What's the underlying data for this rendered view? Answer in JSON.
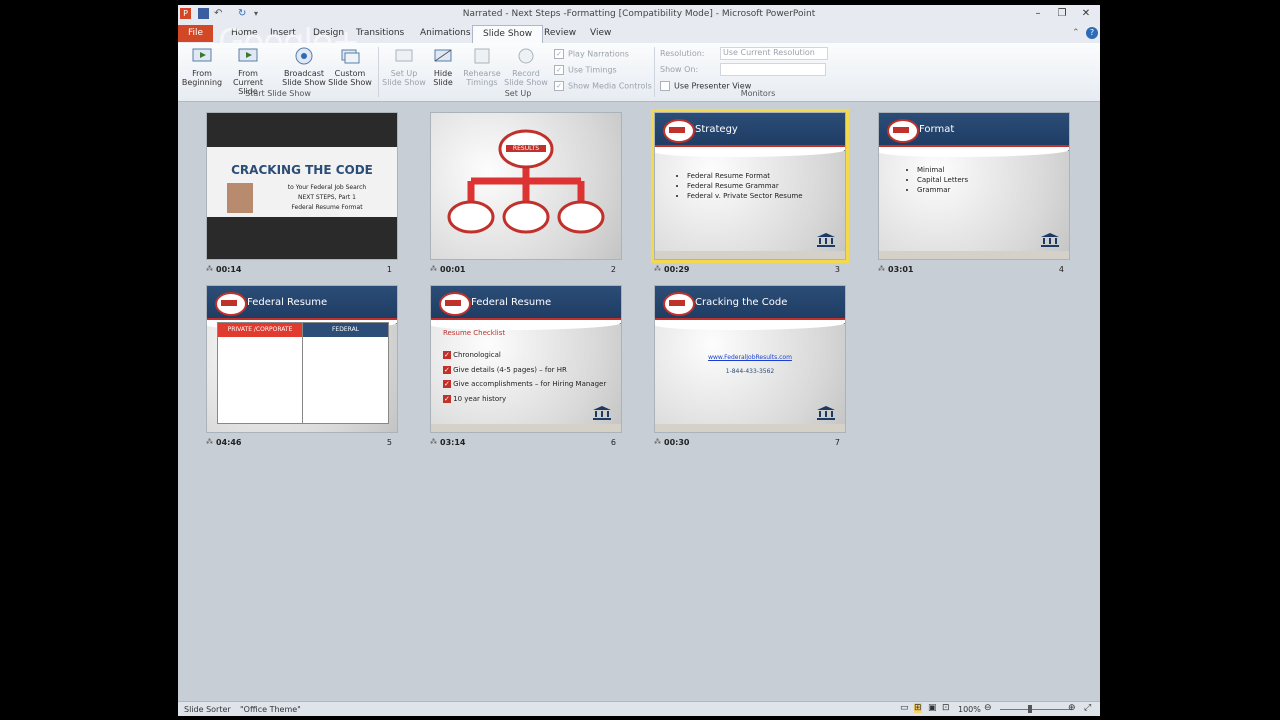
{
  "window": {
    "title": "Narrated - Next Steps -Formatting [Compatibility Mode] - Microsoft PowerPoint"
  },
  "overlay": {
    "text": "Google+"
  },
  "tabs": [
    "File",
    "Home",
    "Insert",
    "Design",
    "Transitions",
    "Animations",
    "Slide Show",
    "Review",
    "View"
  ],
  "ribbon": {
    "start": {
      "from_beginning": "From Beginning",
      "from_current": "From Current Slide",
      "broadcast": "Broadcast Slide Show",
      "custom": "Custom Slide Show",
      "group": "Start Slide Show"
    },
    "setup": {
      "setup_show": "Set Up Slide Show",
      "hide_slide": "Hide Slide",
      "rehearse": "Rehearse Timings",
      "record": "Record Slide Show",
      "play_narrations": "Play Narrations",
      "use_timings": "Use Timings",
      "show_media": "Show Media Controls",
      "group": "Set Up"
    },
    "monitors": {
      "resolution_label": "Resolution:",
      "resolution_value": "Use Current Resolution",
      "show_on_label": "Show On:",
      "presenter_view": "Use Presenter View",
      "group": "Monitors"
    }
  },
  "slides": [
    {
      "num": "1",
      "time": "00:14",
      "title": "CRACKING THE CODE",
      "lines": [
        "to Your Federal Job Search",
        "NEXT STEPS, Part 1",
        "Federal Resume Format"
      ]
    },
    {
      "num": "2",
      "time": "00:01",
      "org": "RESULTS"
    },
    {
      "num": "3",
      "time": "00:29",
      "title": "Strategy",
      "bullets": [
        "Federal Resume Format",
        "Federal Resume Grammar",
        "Federal v. Private Sector Resume"
      ]
    },
    {
      "num": "4",
      "time": "03:01",
      "title": "Format",
      "bullets": [
        "Minimal",
        "Capital Letters",
        "Grammar"
      ]
    },
    {
      "num": "5",
      "time": "04:46",
      "title": "Federal Resume",
      "col1": "PRIVATE /CORPORATE",
      "col2": "FEDERAL"
    },
    {
      "num": "6",
      "time": "03:14",
      "title": "Federal Resume",
      "subtitle": "Resume Checklist",
      "checks": [
        "Chronological",
        "Give details (4-5 pages) – for HR",
        "Give accomplishments – for Hiring Manager",
        "10 year history"
      ]
    },
    {
      "num": "7",
      "time": "00:30",
      "title": "Cracking the Code",
      "link": "www.FederalJobResults.com",
      "phone": "1-844-433-3562"
    }
  ],
  "status": {
    "view": "Slide Sorter",
    "theme": "\"Office Theme\"",
    "zoom": "100%"
  },
  "colors": {
    "selection": "#f4d94c",
    "header": "#1d3a61",
    "accent": "#c0312b"
  }
}
